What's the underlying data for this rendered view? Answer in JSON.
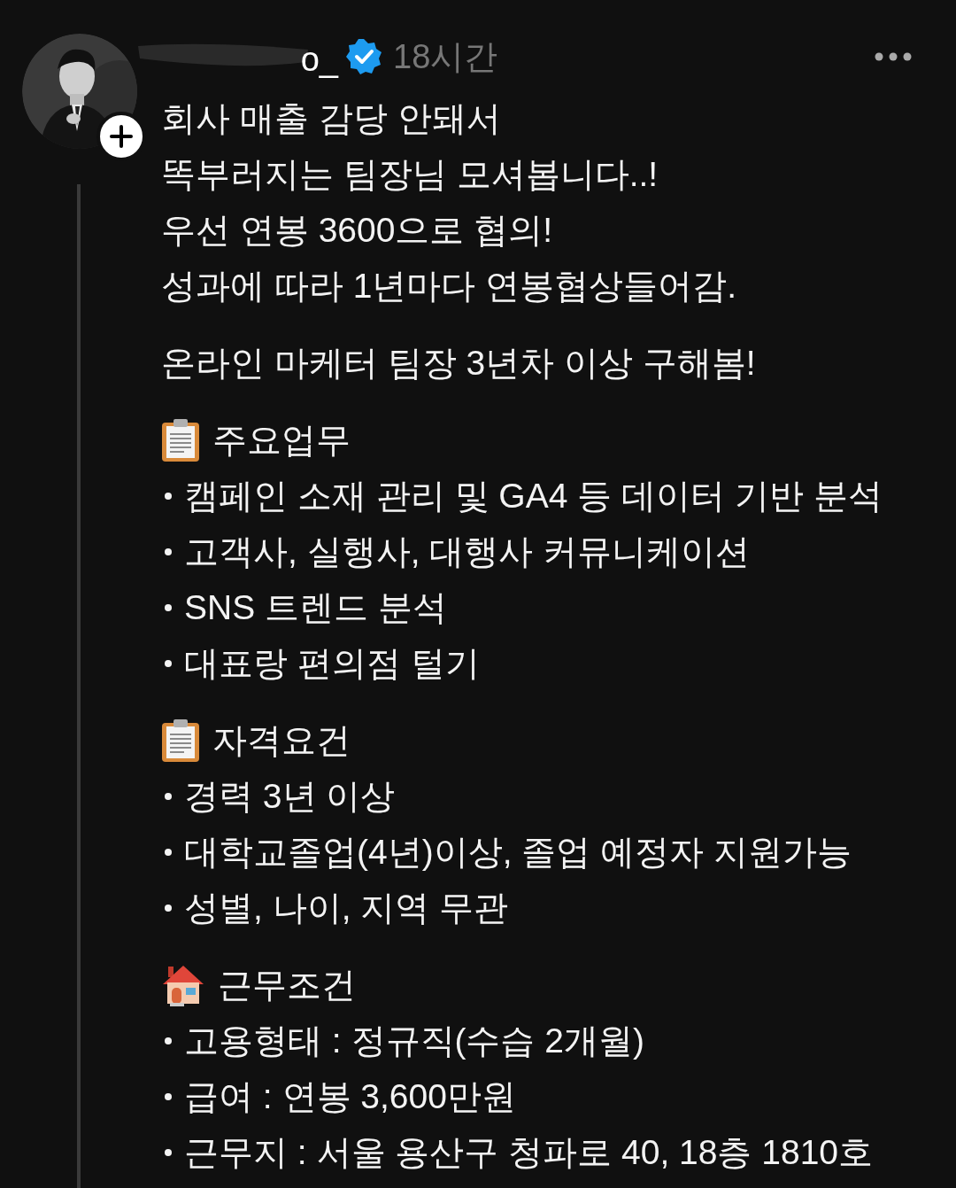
{
  "post": {
    "username": "o_",
    "verified": true,
    "time": "18시간"
  },
  "intro": [
    {
      "lines": [
        "회사 매출 감당 안돼서",
        "똑부러지는 팀장님 모셔봅니다..!",
        "우선 연봉 3600으로 협의!",
        "성과에 따라 1년마다 연봉협상들어감."
      ]
    },
    {
      "lines": [
        "온라인 마케터 팀장 3년차 이상 구해봄!"
      ]
    }
  ],
  "sections": [
    {
      "kind": "clipboard",
      "heading": "주요업무",
      "bullets": [
        "캠페인 소재 관리 및 GA4 등 데이터 기반 분석",
        "고객사, 실행사, 대행사 커뮤니케이션",
        "SNS 트렌드 분석",
        "대표랑 편의점 털기"
      ]
    },
    {
      "kind": "clipboard",
      "heading": "자격요건",
      "bullets": [
        "경력 3년 이상",
        "대학교졸업(4년)이상, 졸업 예정자 지원가능",
        "성별, 나이, 지역 무관"
      ]
    },
    {
      "kind": "house",
      "heading": "근무조건",
      "bullets": [
        "고용형태 : 정규직(수습 2개월)",
        "급여 : 연봉 3,600만원",
        "근무지 : 서울 용산구 청파로 40, 18층 1810호"
      ]
    }
  ]
}
